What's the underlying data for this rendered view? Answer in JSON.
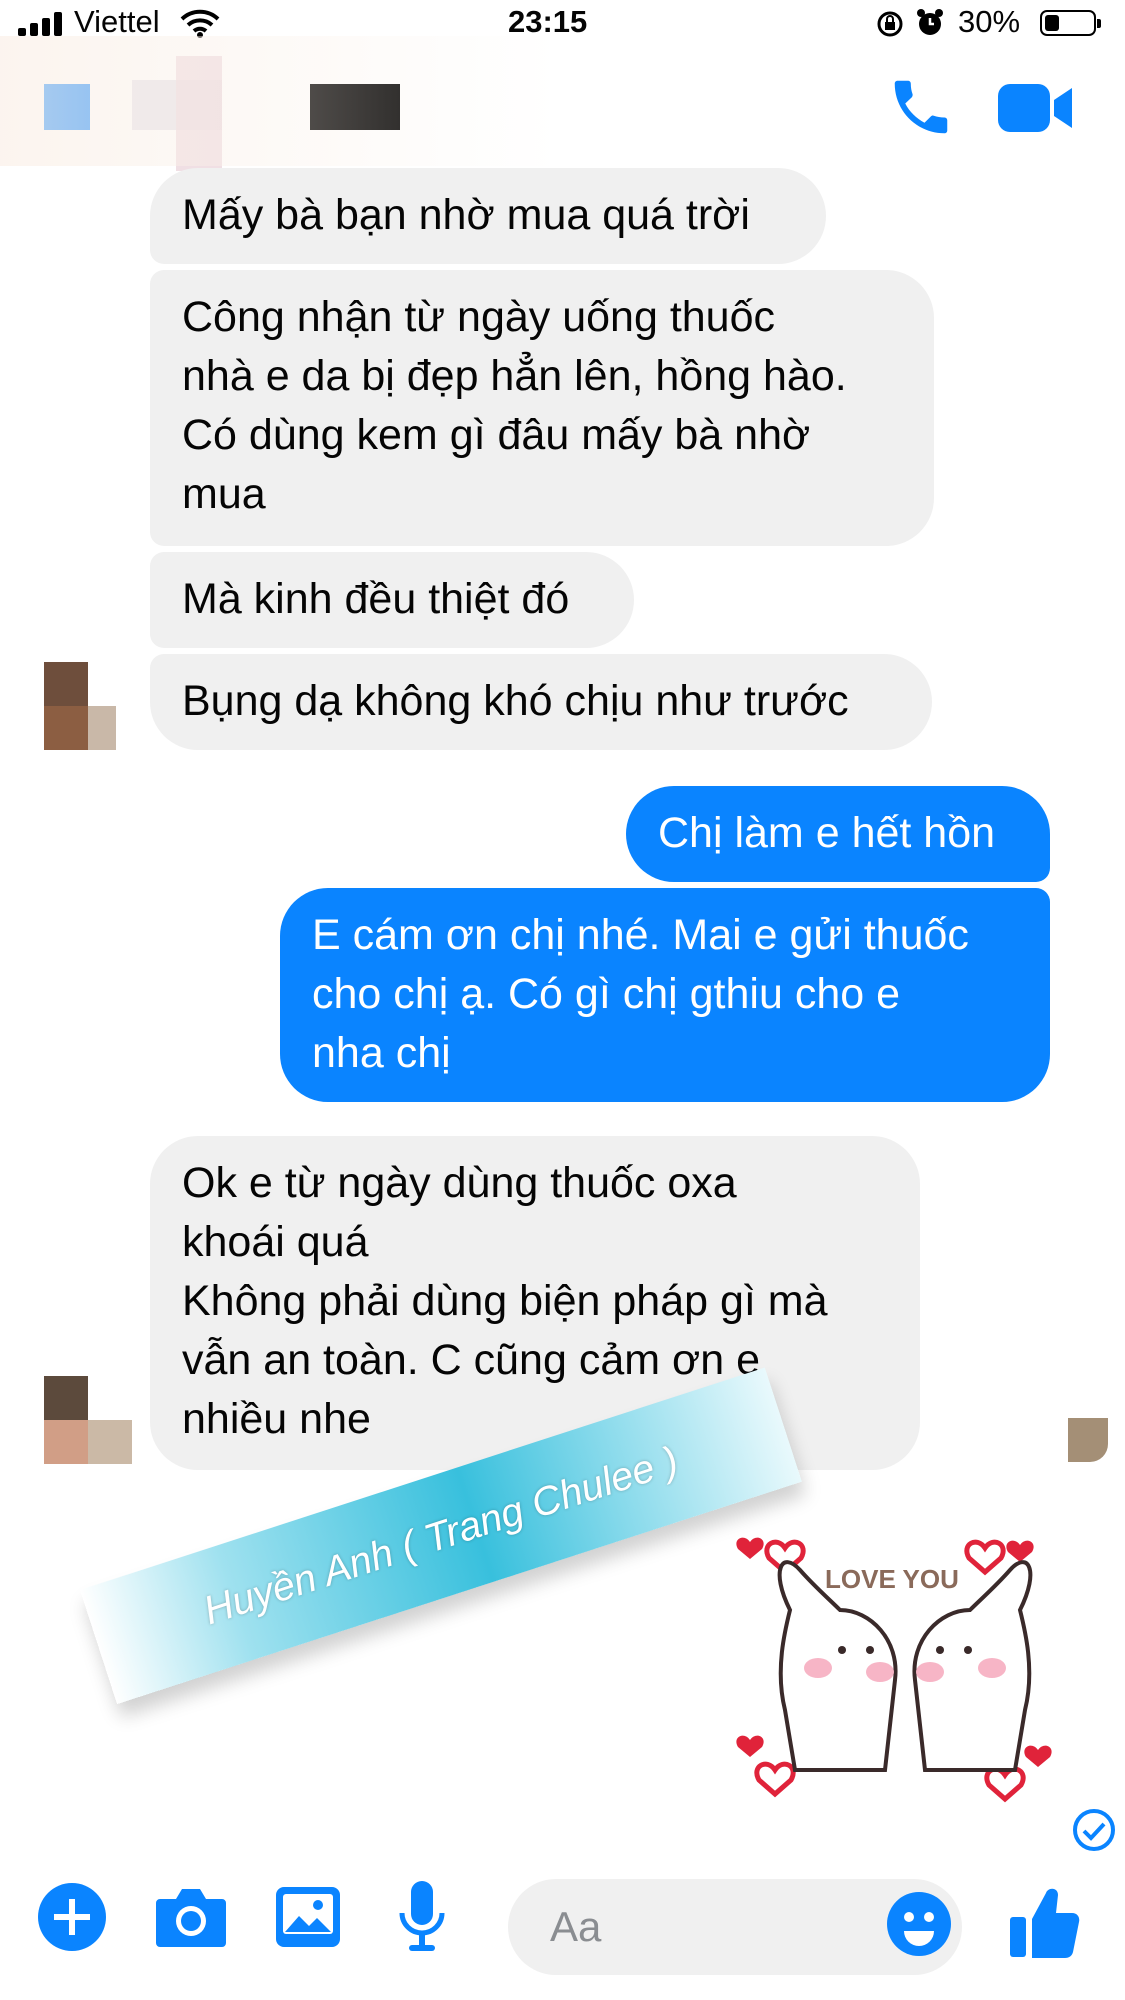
{
  "status_bar": {
    "carrier": "Viettel",
    "time": "23:15",
    "battery_percent": "30%",
    "battery_level": 0.3
  },
  "messages": [
    {
      "side": "received",
      "text": "Mấy  bà bạn nhờ mua quá trời"
    },
    {
      "side": "received",
      "text": "Công nhận từ ngày uống thuốc\nnhà e da bị đẹp hẳn lên, hồng hào.\nCó dùng kem gì đâu mấy bà nhờ\nmua"
    },
    {
      "side": "received",
      "text": "Mà kinh đều thiệt đó"
    },
    {
      "side": "received",
      "text": "Bụng dạ không khó chịu như trước"
    },
    {
      "side": "sent",
      "text": "Chị làm e hết hồn"
    },
    {
      "side": "sent",
      "text": "E cám ơn chị nhé. Mai e gửi thuốc\ncho chị ạ. Có gì chị gthiu cho e\nnha chị"
    },
    {
      "side": "received",
      "text": "Ok e từ ngày dùng thuốc oxa\nkhoái quá\nKhông phải dùng biện pháp gì mà\nvẫn an toàn. C cũng cảm ơn e\nnhiều nhe"
    }
  ],
  "watermark": {
    "text": "Huyền Anh ( Trang Chulee )"
  },
  "sticker": {
    "text": "LOVE YOU",
    "icon": "bunnies-love-you-sticker"
  },
  "composer": {
    "placeholder": "Aa"
  },
  "colors": {
    "accent": "#0a84ff",
    "received_bubble": "#f0f0f0",
    "sent_text": "#ffffff"
  }
}
